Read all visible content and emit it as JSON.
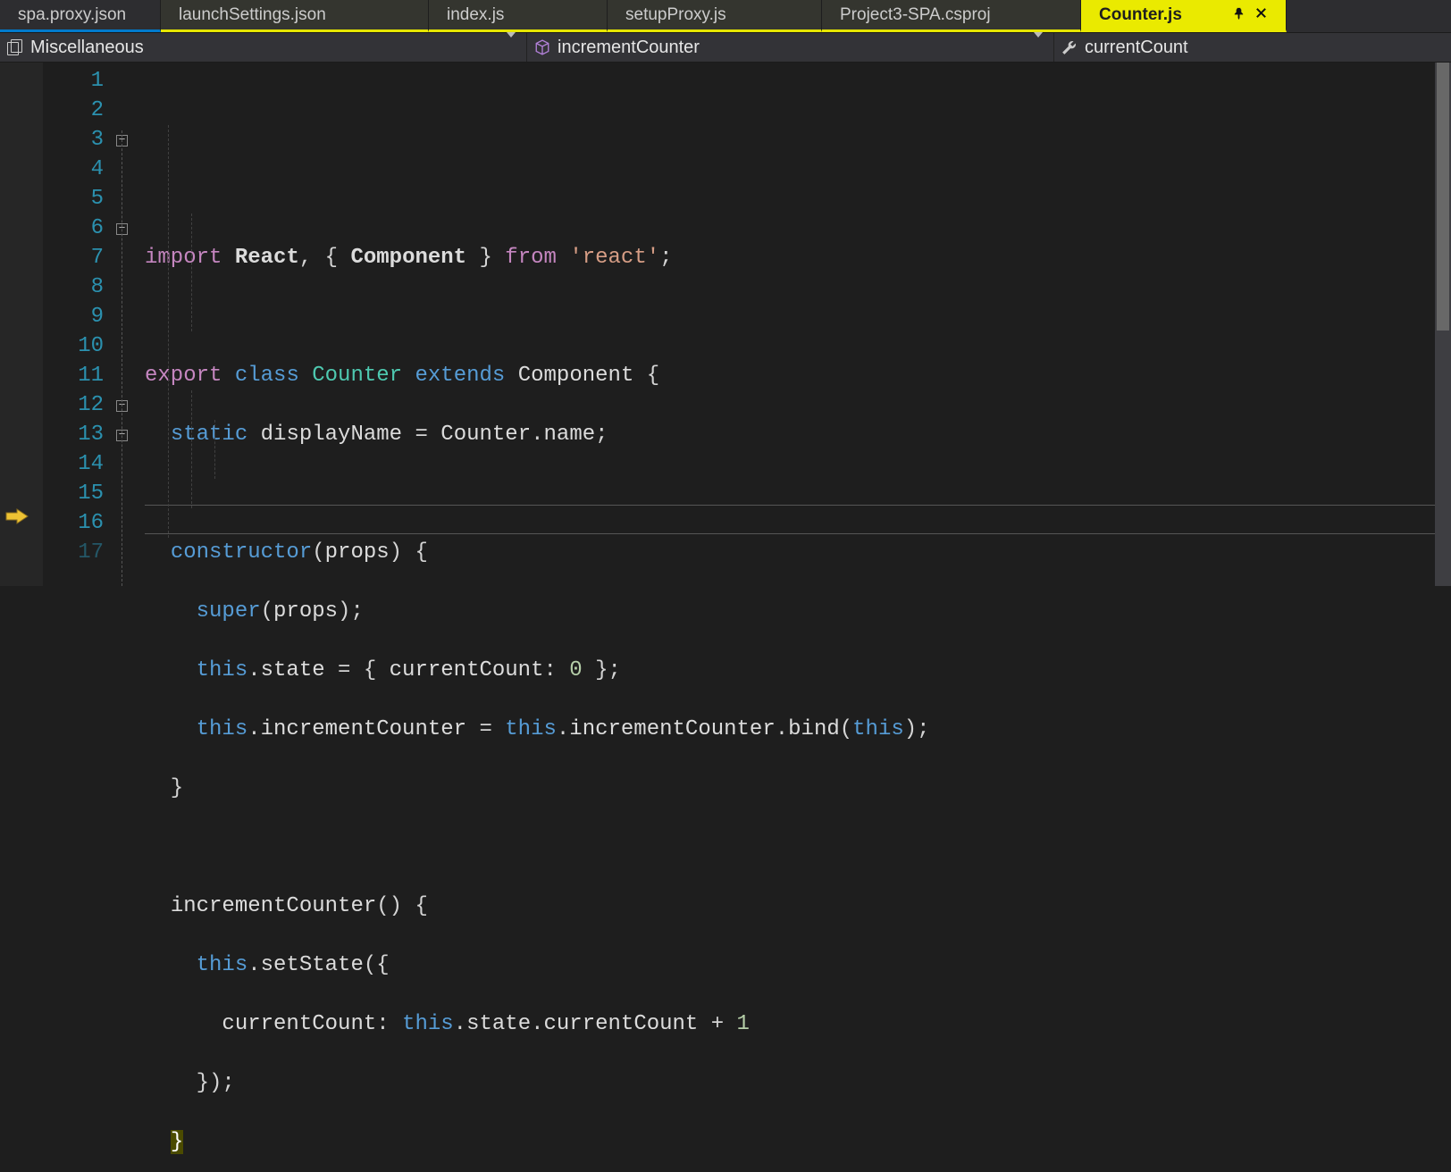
{
  "tabs": [
    {
      "label": "spa.proxy.json",
      "style": "inactive-blue"
    },
    {
      "label": "launchSettings.json",
      "style": "inactive"
    },
    {
      "label": "index.js",
      "style": "inactive"
    },
    {
      "label": "setupProxy.js",
      "style": "inactive"
    },
    {
      "label": "Project3-SPA.csproj",
      "style": "inactive"
    },
    {
      "label": "Counter.js",
      "style": "active"
    }
  ],
  "nav": {
    "scope": "Miscellaneous",
    "member": "incrementCounter",
    "field": "currentCount"
  },
  "line_numbers": [
    "1",
    "2",
    "3",
    "4",
    "5",
    "6",
    "7",
    "8",
    "9",
    "10",
    "11",
    "12",
    "13",
    "14",
    "15",
    "16",
    "17"
  ],
  "fold": {
    "3": "−",
    "6": "−",
    "12": "−",
    "13": "−"
  },
  "code": {
    "l1": {
      "import": "import",
      "react": "React",
      "comp": "Component",
      "from": "from",
      "mod": "'react'"
    },
    "l3": {
      "export": "export",
      "class": "class",
      "name": "Counter",
      "extends": "extends",
      "base": "Component"
    },
    "l4": {
      "static": "static",
      "dn": "displayName",
      "ctr": "Counter",
      "name": "name"
    },
    "l6": {
      "ctor": "constructor",
      "props": "props"
    },
    "l7": {
      "super": "super",
      "props": "props"
    },
    "l8": {
      "this": "this",
      "state": "state",
      "cc": "currentCount",
      "zero": "0"
    },
    "l9": {
      "this": "this",
      "ic": "incrementCounter",
      "bind": "bind"
    },
    "l12": {
      "ic": "incrementCounter"
    },
    "l13": {
      "this": "this",
      "ss": "setState"
    },
    "l14": {
      "cc": "currentCount",
      "this": "this",
      "state": "state",
      "one": "1"
    }
  },
  "breakpoint_line": 16
}
